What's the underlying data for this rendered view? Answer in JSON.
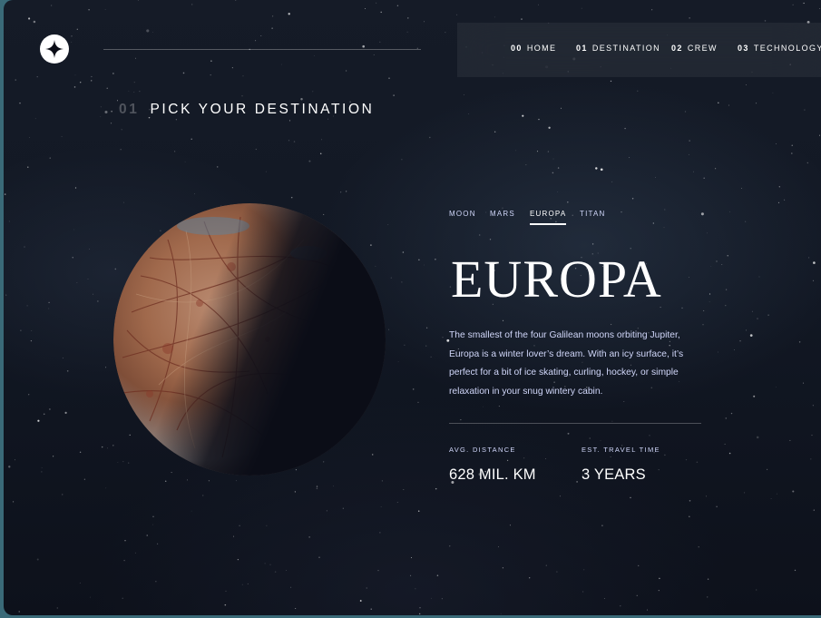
{
  "header": {
    "logo_icon": "star-logo-icon",
    "nav": [
      {
        "num": "00",
        "label": "HOME"
      },
      {
        "num": "01",
        "label": "DESTINATION"
      },
      {
        "num": "02",
        "label": "CREW"
      },
      {
        "num": "03",
        "label": "TECHNOLOGY"
      }
    ]
  },
  "page_title": {
    "num": "01",
    "text": "PICK YOUR DESTINATION"
  },
  "tabs": [
    "MOON",
    "MARS",
    "EUROPA",
    "TITAN"
  ],
  "active_tab": "EUROPA",
  "destination": {
    "name": "EUROPA",
    "description": "The smallest of the four Galilean moons orbiting Jupiter, Europa is a winter lover’s dream. With an icy surface, it’s perfect for a bit of ice skating, curling, hockey, or simple relaxation in your snug wintery cabin.",
    "distance_label": "AVG. DISTANCE",
    "distance_value": "628 MIL. KM",
    "travel_label": "EST. TRAVEL TIME",
    "travel_value": "3 YEARS"
  },
  "colors": {
    "background": "#0b0d17",
    "accent_text": "#d0d6f9",
    "white": "#ffffff"
  }
}
